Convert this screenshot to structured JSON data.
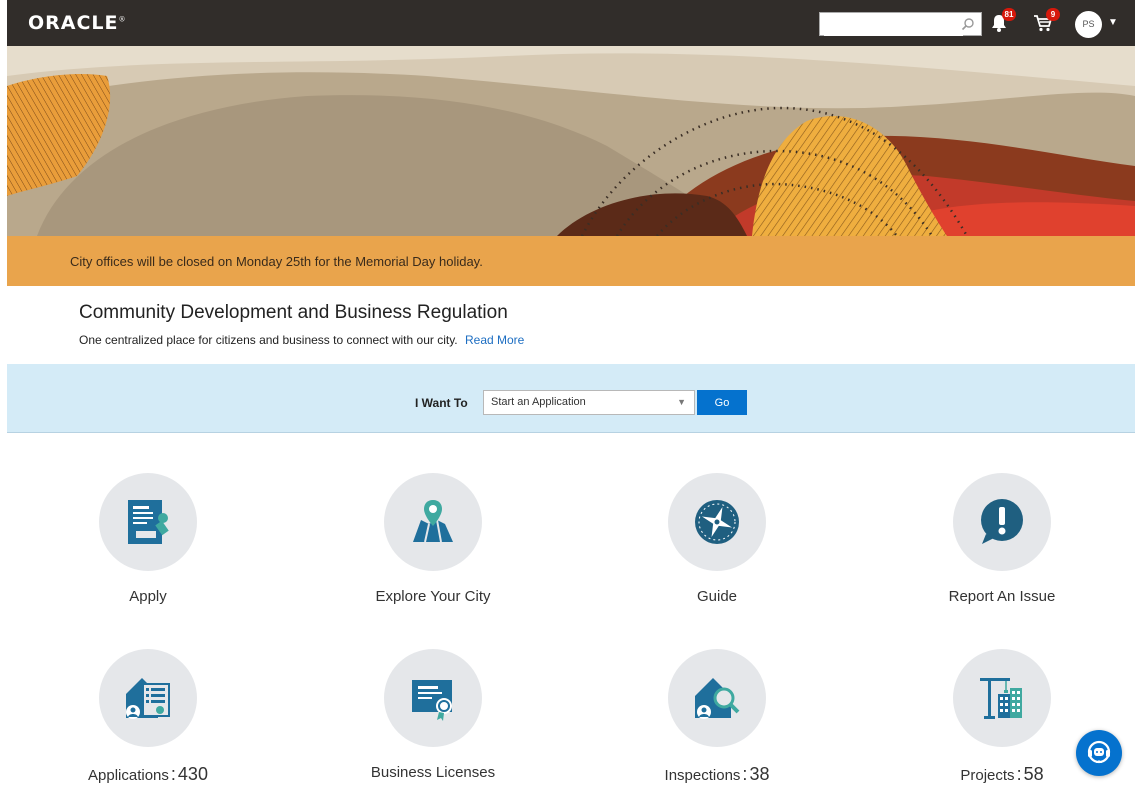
{
  "header": {
    "logo_text": "ORACLE",
    "search": {
      "value": "",
      "placeholder": ""
    },
    "notifications": {
      "icon": "bell-icon",
      "count": "81"
    },
    "cart": {
      "icon": "cart-icon",
      "count": "9"
    },
    "user": {
      "initials": "PS"
    }
  },
  "notice": {
    "text": "City offices will be closed on Monday 25th for the Memorial Day holiday."
  },
  "intro": {
    "title": "Community Development and Business Regulation",
    "description": "One centralized place for citizens and business to connect with our city.",
    "read_more": "Read More"
  },
  "i_want_to": {
    "label": "I Want To",
    "selected": "Start an Application",
    "go_label": "Go"
  },
  "tiles_row1": [
    {
      "label": "Apply",
      "icon": "application-form-icon"
    },
    {
      "label": "Explore Your City",
      "icon": "map-pin-icon"
    },
    {
      "label": "Guide",
      "icon": "compass-icon"
    },
    {
      "label": "Report An Issue",
      "icon": "exclamation-chat-icon"
    }
  ],
  "tiles_row2": [
    {
      "label": "Applications",
      "count": "430",
      "icon": "applications-house-icon"
    },
    {
      "label": "Business Licenses",
      "count": "",
      "icon": "certificate-icon"
    },
    {
      "label": "Inspections",
      "count": "38",
      "icon": "inspection-house-icon"
    },
    {
      "label": "Projects",
      "count": "58",
      "icon": "crane-building-icon"
    }
  ],
  "colors": {
    "accent": "#0572ce",
    "header": "#312d2a",
    "notice": "#e9a44c",
    "want_bar": "#d4ebf7",
    "icon": "#1f6f9c"
  },
  "chat": {
    "icon": "chat-assistant-icon"
  }
}
